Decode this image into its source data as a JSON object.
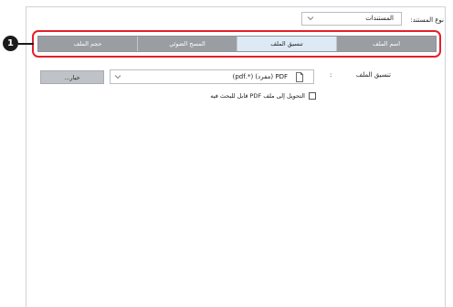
{
  "document_type": {
    "label": "نوع المستند:",
    "value": "المستندات"
  },
  "tabs": [
    {
      "label": "اسم الملف",
      "active": false
    },
    {
      "label": "تنسيق الملف",
      "active": true
    },
    {
      "label": "المسح الضوئي",
      "active": false
    },
    {
      "label": "حجم الملف",
      "active": false
    }
  ],
  "callout": {
    "number": "1",
    "color": "#e5202a"
  },
  "file_format": {
    "label": "تنسيق الملف",
    "colon": ":",
    "value": "PDF (مفرد) (*.pdf)",
    "icon": "file-icon"
  },
  "options_button": {
    "label": "خيار..."
  },
  "searchable_pdf": {
    "label": "التحويل إلى ملف PDF قابل للبحث فيه",
    "checked": false
  },
  "colors": {
    "tab_inactive": "#9a9ea3",
    "tab_active": "#ddeaf6",
    "button": "#bfc3c7"
  }
}
